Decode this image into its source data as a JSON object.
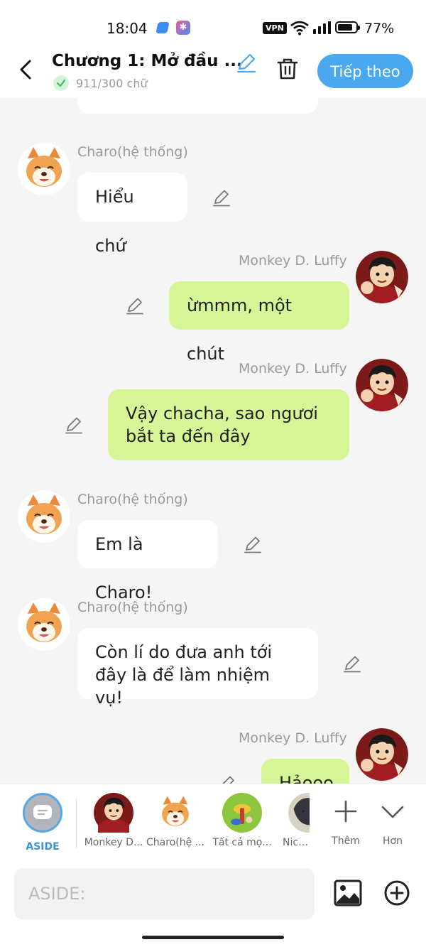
{
  "status_bar": {
    "time": "18:04",
    "vpn": "VPN",
    "battery": "77%",
    "app2_glyph": "✱"
  },
  "header": {
    "title": "Chương 1: Mở đầu ...",
    "word_count": "911/300 chữ",
    "next_label": "Tiếp theo"
  },
  "messages": [
    {
      "side": "left",
      "name": "Charo(hệ thống)",
      "text": "Hiểu chứ"
    },
    {
      "side": "right",
      "name": "Monkey D. Luffy",
      "text": "ừmmm, một chút"
    },
    {
      "side": "right",
      "name": "Monkey D. Luffy",
      "text": "Vậy chacha, sao ngươi\nbắt ta đến đây"
    },
    {
      "side": "left",
      "name": "Charo(hệ thống)",
      "text": "Em là Charo!"
    },
    {
      "side": "left",
      "name": "Charo(hệ thống)",
      "text": "Còn lí do đưa anh tới\nđây là để làm nhiệm vụ!"
    },
    {
      "side": "right",
      "name": "Monkey D. Luffy",
      "text": "Hảooo"
    }
  ],
  "characters": {
    "aside": "ASIDE",
    "items": [
      "Monkey D...",
      "Charo(hệ ...",
      "Tất cả mọ...",
      "Nico R"
    ],
    "more": "Thêm",
    "expand": "Hơn"
  },
  "composer": {
    "placeholder": "ASIDE:"
  },
  "colors": {
    "accent": "#4aa8ef",
    "right_bubble": "#d5f596",
    "left_bubble": "#ffffff"
  }
}
